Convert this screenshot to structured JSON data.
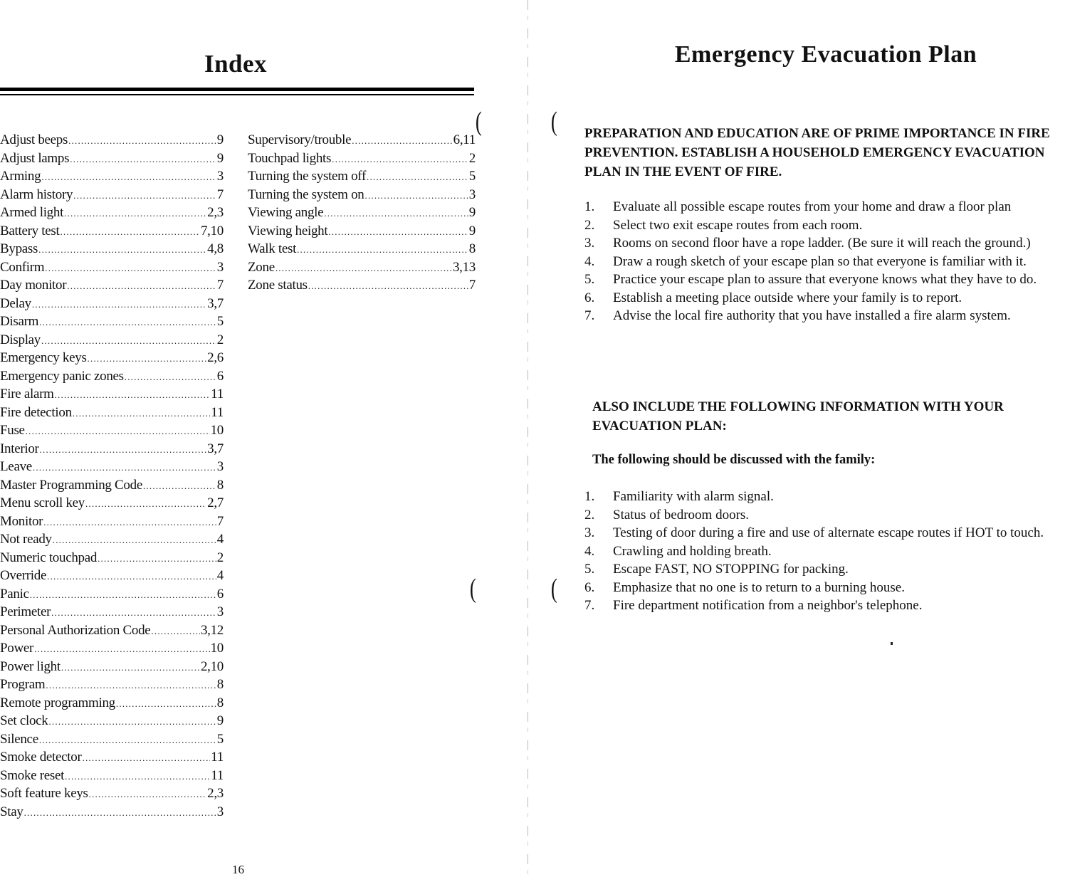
{
  "index_page": {
    "title": "Index",
    "page_number": "16",
    "column1": [
      {
        "term": "Adjust beeps",
        "pages": "9"
      },
      {
        "term": "Adjust lamps",
        "pages": "9"
      },
      {
        "term": "Arming",
        "pages": "3"
      },
      {
        "term": "Alarm history",
        "pages": "7"
      },
      {
        "term": "Armed light",
        "pages": "2,3"
      },
      {
        "term": "Battery test",
        "pages": "7,10"
      },
      {
        "term": "Bypass",
        "pages": "4,8"
      },
      {
        "term": "Confirm",
        "pages": "3"
      },
      {
        "term": "Day monitor",
        "pages": "7"
      },
      {
        "term": "Delay",
        "pages": "3,7"
      },
      {
        "term": "Disarm",
        "pages": "5"
      },
      {
        "term": "Display",
        "pages": "2"
      },
      {
        "term": "Emergency keys",
        "pages": "2,6"
      },
      {
        "term": "Emergency panic zones",
        "pages": "6"
      },
      {
        "term": "Fire alarm",
        "pages": "11"
      },
      {
        "term": "Fire detection",
        "pages": "11"
      },
      {
        "term": "Fuse",
        "pages": "10"
      },
      {
        "term": "Interior",
        "pages": "3,7"
      },
      {
        "term": "Leave",
        "pages": "3"
      },
      {
        "term": "Master Programming Code",
        "pages": "8"
      },
      {
        "term": "Menu scroll key",
        "pages": "2,7"
      },
      {
        "term": "Monitor",
        "pages": "7"
      },
      {
        "term": "Not ready",
        "pages": "4"
      },
      {
        "term": "Numeric touchpad",
        "pages": "2"
      },
      {
        "term": "Override",
        "pages": "4"
      },
      {
        "term": "Panic",
        "pages": "6"
      },
      {
        "term": "Perimeter",
        "pages": "3"
      },
      {
        "term": "Personal Authorization Code",
        "pages": "3,12"
      },
      {
        "term": "Power",
        "pages": "10"
      },
      {
        "term": "Power light",
        "pages": "2,10"
      },
      {
        "term": "Program",
        "pages": "8"
      },
      {
        "term": "Remote programming",
        "pages": "8"
      },
      {
        "term": "Set clock",
        "pages": "9"
      },
      {
        "term": "Silence",
        "pages": "5"
      },
      {
        "term": "Smoke detector",
        "pages": "11"
      },
      {
        "term": "Smoke reset",
        "pages": "11"
      },
      {
        "term": "Soft feature keys",
        "pages": "2,3"
      },
      {
        "term": "Stay",
        "pages": "3"
      }
    ],
    "column2": [
      {
        "term": "Supervisory/trouble",
        "pages": "6,11"
      },
      {
        "term": "Touchpad lights",
        "pages": "2"
      },
      {
        "term": "Turning the system off",
        "pages": "5"
      },
      {
        "term": "Turning the system on",
        "pages": "3"
      },
      {
        "term": "Viewing angle",
        "pages": "9"
      },
      {
        "term": "Viewing height",
        "pages": "9"
      },
      {
        "term": "Walk test",
        "pages": "8"
      },
      {
        "term": "Zone",
        "pages": "3,13"
      },
      {
        "term": "Zone status",
        "pages": "7"
      }
    ]
  },
  "plan_page": {
    "title": "Emergency Evacuation Plan",
    "intro": "PREPARATION AND EDUCATION ARE OF PRIME IMPORTANCE IN FIRE PREVENTION.  ESTABLISH A HOUSEHOLD EMERGENCY EVACUATION PLAN IN THE EVENT OF FIRE.",
    "steps": [
      {
        "num": "1.",
        "text": "Evaluate all possible escape routes from your home and draw a floor plan"
      },
      {
        "num": "2.",
        "text": "Select two exit escape routes from each room."
      },
      {
        "num": "3.",
        "text": "Rooms on second floor have a rope ladder. (Be sure it will reach the ground.)"
      },
      {
        "num": "4.",
        "text": "Draw a rough sketch of your escape plan so that everyone is familiar with it."
      },
      {
        "num": "5.",
        "text": "Practice your escape plan to assure that everyone knows what they have to do."
      },
      {
        "num": "6.",
        "text": "Establish a meeting place outside where your family is to report."
      },
      {
        "num": "7.",
        "text": "Advise the local fire authority that you have installed a fire alarm system."
      }
    ],
    "also_heading": "ALSO INCLUDE THE FOLLOWING INFORMATION WITH YOUR EVACUATION PLAN:",
    "discuss_heading": "The following should be discussed with the family:",
    "discuss_items": [
      {
        "num": "1.",
        "text": "Familiarity with alarm signal."
      },
      {
        "num": "2.",
        "text": "Status of bedroom doors."
      },
      {
        "num": "3.",
        "text": "Testing of door during a fire and use of alternate escape routes if HOT to touch."
      },
      {
        "num": "4.",
        "text": "Crawling and holding breath."
      },
      {
        "num": "5.",
        "text": "Escape FAST, NO STOPPING  for packing."
      },
      {
        "num": "6.",
        "text": "Emphasize that no one is to return to a burning house."
      },
      {
        "num": "7.",
        "text": "Fire department notification from a neighbor's telephone."
      }
    ]
  }
}
